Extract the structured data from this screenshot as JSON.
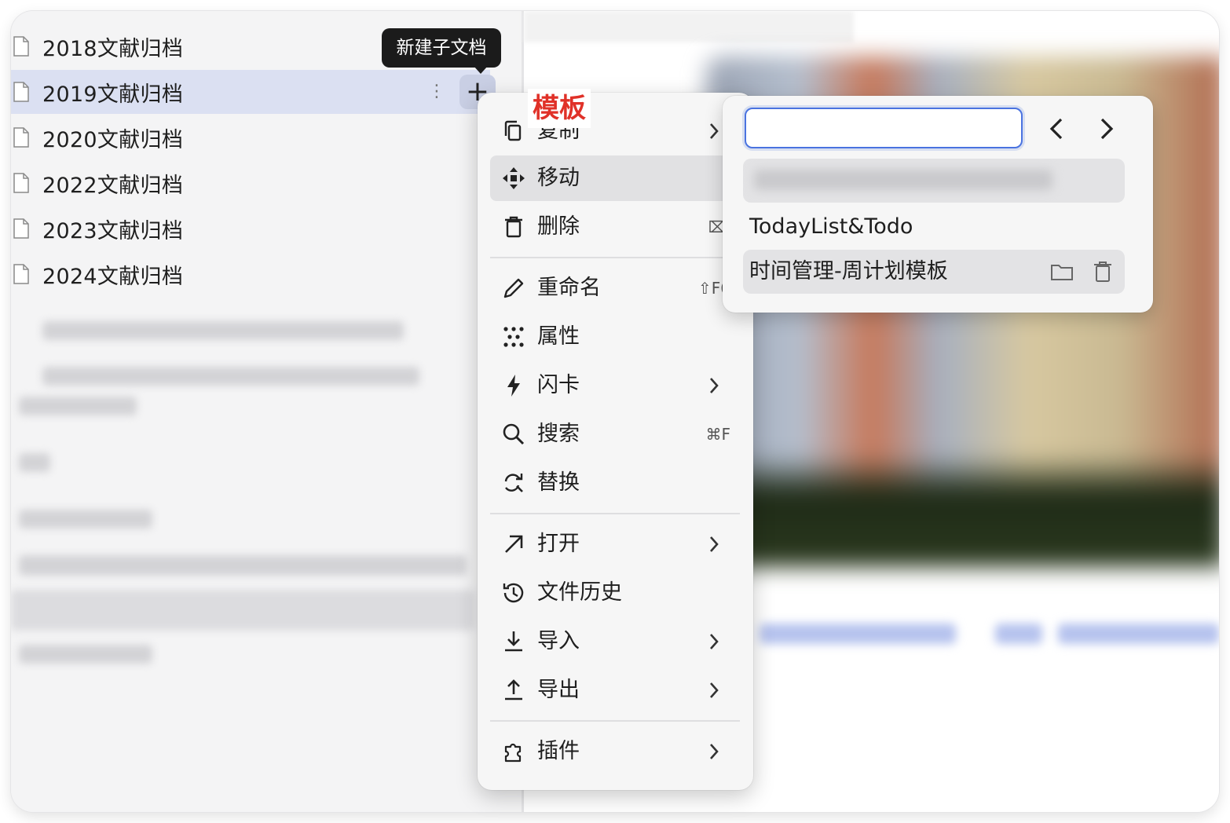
{
  "sidebar": {
    "docs": [
      {
        "label": "2018文献归档",
        "icon": "document-icon"
      },
      {
        "label": "2019文献归档",
        "icon": "document-icon",
        "selected": true
      },
      {
        "label": "2020文献归档",
        "icon": "document-icon"
      },
      {
        "label": "2022文献归档",
        "icon": "document-icon"
      },
      {
        "label": "2023文献归档",
        "icon": "document-icon"
      },
      {
        "label": "2024文献归档",
        "icon": "document-icon"
      }
    ],
    "more_glyph": "⋮",
    "add_glyph": "+"
  },
  "tooltip": {
    "text": "新建子文档"
  },
  "annotation": {
    "text": "模板",
    "color": "#e03128"
  },
  "context_menu": {
    "items": [
      {
        "label": "复制",
        "icon": "copy-icon",
        "has_submenu": true
      },
      {
        "label": "移动",
        "icon": "move-icon",
        "active": true
      },
      {
        "label": "删除",
        "icon": "trash-icon",
        "shortcut": "⌦"
      },
      {
        "label": "重命名",
        "icon": "pencil-icon",
        "shortcut": "⇧F6"
      },
      {
        "label": "属性",
        "icon": "attributes-icon"
      },
      {
        "label": "闪卡",
        "icon": "lightning-icon",
        "has_submenu": true
      },
      {
        "label": "搜索",
        "icon": "search-icon",
        "shortcut": "⌘F"
      },
      {
        "label": "替换",
        "icon": "replace-icon"
      },
      {
        "label": "打开",
        "icon": "arrow-up-right-icon",
        "has_submenu": true
      },
      {
        "label": "文件历史",
        "icon": "history-icon"
      },
      {
        "label": "导入",
        "icon": "import-icon",
        "has_submenu": true
      },
      {
        "label": "导出",
        "icon": "export-icon",
        "has_submenu": true
      },
      {
        "label": "插件",
        "icon": "plugin-icon",
        "has_submenu": true
      }
    ]
  },
  "template_panel": {
    "search_value": "",
    "items": [
      {
        "label": "TodayList&Todo"
      },
      {
        "label": "时间管理-周计划模板",
        "active": true
      }
    ],
    "icons": [
      "chevron-left-icon",
      "chevron-right-icon",
      "folder-icon",
      "trash-icon"
    ]
  },
  "colors": {
    "selection": "#dbe0f2",
    "accent": "#4a73e0",
    "menu_bg": "#f6f6f6",
    "sidebar_bg": "#f4f4f5"
  }
}
